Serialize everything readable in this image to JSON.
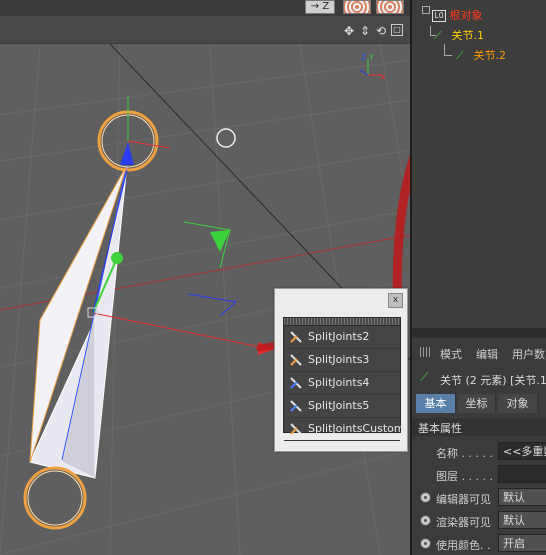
{
  "viewport": {
    "toolbar": {
      "nav_icons": [
        "move-view-icon",
        "zoom-view-icon",
        "rotate-view-icon",
        "maximize-view-icon"
      ]
    },
    "top_buttons": [
      {
        "label": "→ Z",
        "icon": "direction-icon"
      },
      {
        "label": "",
        "icon": "texture-pattern-icon"
      },
      {
        "label": "",
        "icon": "texture-pattern-icon"
      }
    ],
    "axis_gizmo": {
      "x": "X",
      "y": "Y",
      "z": "Z"
    }
  },
  "object_manager": {
    "items": [
      {
        "label": "根对象",
        "icon": "null-object-icon",
        "color": "#ff3a1a",
        "level": 0
      },
      {
        "label": "关节.1",
        "icon": "joint-icon",
        "color": "#ffd000",
        "level": 1
      },
      {
        "label": "关节.2",
        "icon": "joint-icon",
        "color": "#ff9a00",
        "level": 2
      }
    ]
  },
  "command_palette": {
    "close_label": "x",
    "items": [
      {
        "label": "SplitJoints2",
        "icon": "split-joints-icon"
      },
      {
        "label": "SplitJoints3",
        "icon": "split-joints-icon"
      },
      {
        "label": "SplitJoints4",
        "icon": "split-joints-icon"
      },
      {
        "label": "SplitJoints5",
        "icon": "split-joints-icon"
      },
      {
        "label": "SplitJointsCustom",
        "icon": "split-joints-icon"
      }
    ]
  },
  "attribute_manager": {
    "menu": [
      "模式",
      "编辑",
      "用户数"
    ],
    "title": "关节 (2 元素) [关节.1,",
    "tabs": [
      {
        "label": "基本",
        "active": true
      },
      {
        "label": "坐标",
        "active": false
      },
      {
        "label": "对象",
        "active": false
      }
    ],
    "section_title": "基本属性",
    "properties": [
      {
        "label": "名称 . . . . .",
        "value": "<<多重数"
      },
      {
        "label": "图层 . . . . .",
        "value": ""
      },
      {
        "label": "编辑器可见",
        "value": "默认"
      },
      {
        "label": "渲染器可见",
        "value": "默认"
      },
      {
        "label": "使用颜色. .",
        "value": "开启"
      }
    ]
  },
  "colors": {
    "annotation": "#c0171a",
    "gizmo_x": "#e53030",
    "gizmo_y": "#3cd23c",
    "gizmo_z": "#2a3cf0",
    "joint_ring": "#f0a040",
    "active_tab": "#5a7fa8"
  }
}
